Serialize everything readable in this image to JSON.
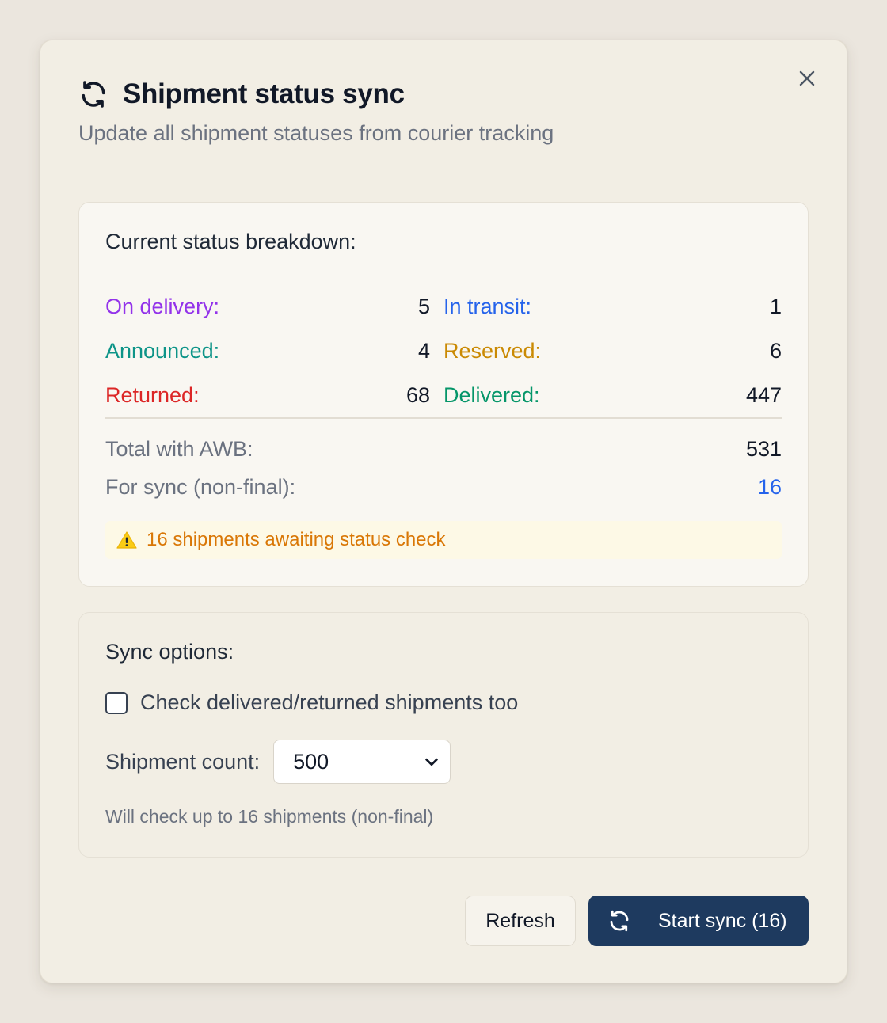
{
  "dialog": {
    "title": "Shipment status sync",
    "subtitle": "Update all shipment statuses from courier tracking"
  },
  "breakdown": {
    "title": "Current status breakdown:",
    "rows": [
      {
        "left": {
          "label": "On delivery:",
          "value": "5",
          "color": "#9333ea"
        },
        "right": {
          "label": "In transit:",
          "value": "1",
          "color": "#2563eb"
        }
      },
      {
        "left": {
          "label": "Announced:",
          "value": "4",
          "color": "#0d9488"
        },
        "right": {
          "label": "Reserved:",
          "value": "6",
          "color": "#ca8a04"
        }
      },
      {
        "left": {
          "label": "Returned:",
          "value": "68",
          "color": "#dc2626"
        },
        "right": {
          "label": "Delivered:",
          "value": "447",
          "color": "#059669"
        }
      }
    ],
    "total_label": "Total with AWB:",
    "total_value": "531",
    "sync_label": "For sync (non-final):",
    "sync_value": "16",
    "sync_value_color": "#2563eb",
    "warning_text": "16 shipments awaiting status check"
  },
  "options": {
    "title": "Sync options:",
    "checkbox_label": "Check delivered/returned shipments too",
    "checkbox_checked": false,
    "count_label": "Shipment count:",
    "count_value": "500",
    "hint": "Will check up to 16 shipments (non-final)"
  },
  "footer": {
    "refresh_label": "Refresh",
    "start_label": "Start sync (16)"
  },
  "colors": {
    "primary_button": "#1e3a5f",
    "warning_text": "#d97706",
    "warning_bg": "#fdf9e6"
  }
}
